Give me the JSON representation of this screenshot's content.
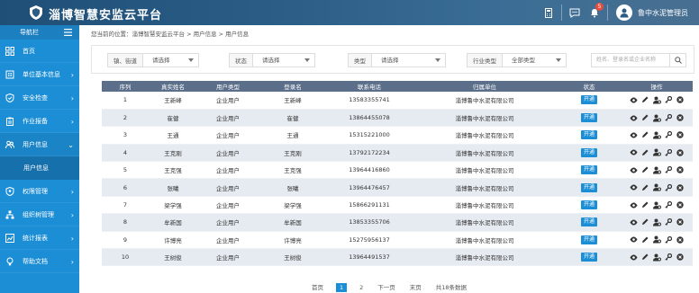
{
  "header": {
    "title": "淄博智慧安监云平台",
    "notification_count": "5",
    "username": "鲁中水泥管理员"
  },
  "sidebar": {
    "nav_label": "导航栏",
    "items": [
      {
        "label": "首页",
        "icon": "home-icon",
        "chevron": ""
      },
      {
        "label": "单位基本信息",
        "icon": "building-icon",
        "chevron": "›"
      },
      {
        "label": "安全检查",
        "icon": "shield-icon",
        "chevron": "›"
      },
      {
        "label": "作业报备",
        "icon": "clipboard-icon",
        "chevron": "›"
      },
      {
        "label": "用户信息",
        "icon": "users-icon",
        "chevron": "⌄"
      }
    ],
    "sub_item": "用户信息",
    "items2": [
      {
        "label": "权限管理",
        "icon": "permission-icon",
        "chevron": "›"
      },
      {
        "label": "组织树管理",
        "icon": "org-tree-icon",
        "chevron": "›"
      },
      {
        "label": "统计报表",
        "icon": "chart-icon",
        "chevron": "›"
      },
      {
        "label": "帮助文档",
        "icon": "bulb-icon",
        "chevron": "›"
      }
    ]
  },
  "breadcrumb": "您当前的位置：淄博智慧安监云平台 > 用户信息 > 用户信息",
  "filters": {
    "town_label": "镇、街道",
    "town_value": "请选择",
    "status_label": "状态",
    "status_value": "请选择",
    "type_label": "类型",
    "type_value": "请选择",
    "industry_label": "行业类型",
    "industry_value": "全部类型",
    "search_placeholder": "姓名、登录名或企业名称"
  },
  "table": {
    "headers": [
      "序列",
      "真实姓名",
      "用户类型",
      "登录名",
      "联系电话",
      "归属单位",
      "状态",
      "操作"
    ],
    "rows": [
      {
        "no": "1",
        "name": "王新峰",
        "type": "企业用户",
        "login": "王新峰",
        "phone": "13583355741",
        "unit": "淄博鲁中水泥有限公司",
        "status": "开通"
      },
      {
        "no": "2",
        "name": "崔健",
        "type": "企业用户",
        "login": "崔健",
        "phone": "13864455078",
        "unit": "淄博鲁中水泥有限公司",
        "status": "开通"
      },
      {
        "no": "3",
        "name": "王通",
        "type": "企业用户",
        "login": "王通",
        "phone": "15315221000",
        "unit": "淄博鲁中水泥有限公司",
        "status": "开通"
      },
      {
        "no": "4",
        "name": "王克刚",
        "type": "企业用户",
        "login": "王克刚",
        "phone": "13792172234",
        "unit": "淄博鲁中水泥有限公司",
        "status": "开通"
      },
      {
        "no": "5",
        "name": "王克强",
        "type": "企业用户",
        "login": "王克强",
        "phone": "13964416860",
        "unit": "淄博鲁中水泥有限公司",
        "status": "开通"
      },
      {
        "no": "6",
        "name": "张曦",
        "type": "企业用户",
        "login": "张曦",
        "phone": "13964476457",
        "unit": "淄博鲁中水泥有限公司",
        "status": "开通"
      },
      {
        "no": "7",
        "name": "梁学强",
        "type": "企业用户",
        "login": "梁学强",
        "phone": "15866291131",
        "unit": "淄博鲁中水泥有限公司",
        "status": "开通"
      },
      {
        "no": "8",
        "name": "牟新国",
        "type": "企业用户",
        "login": "牟新国",
        "phone": "13853355706",
        "unit": "淄博鲁中水泥有限公司",
        "status": "开通"
      },
      {
        "no": "9",
        "name": "许博亮",
        "type": "企业用户",
        "login": "许博亮",
        "phone": "15275956137",
        "unit": "淄博鲁中水泥有限公司",
        "status": "开通"
      },
      {
        "no": "10",
        "name": "王树俊",
        "type": "企业用户",
        "login": "王树俊",
        "phone": "13964491537",
        "unit": "淄博鲁中水泥有限公司",
        "status": "开通"
      }
    ]
  },
  "pager": {
    "first": "首页",
    "page1": "1",
    "page2": "2",
    "next": "下一页",
    "last": "末页",
    "total": "共18条数据"
  },
  "colors": {
    "topbar": "#2b5d86",
    "sidebar": "#1c8ed5",
    "table_header": "#5b6f8a",
    "status_button": "#1c8ed5"
  }
}
